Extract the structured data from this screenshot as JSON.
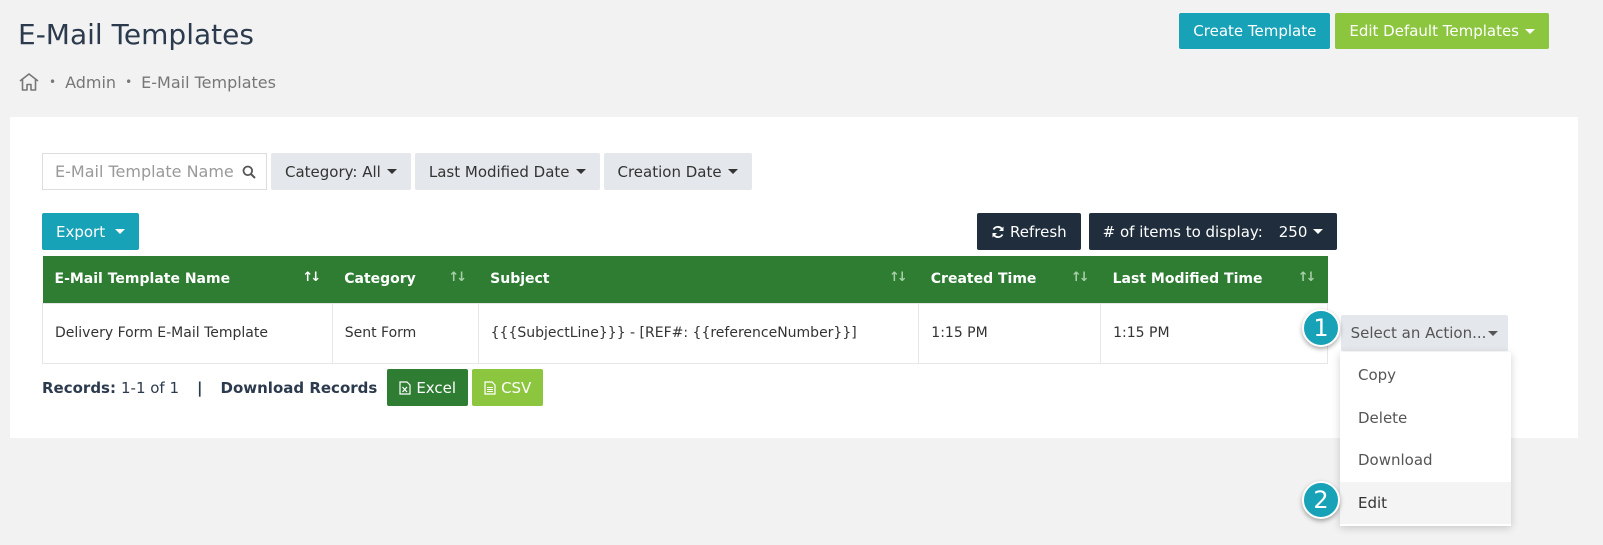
{
  "page": {
    "title": "E-Mail Templates"
  },
  "top_actions": {
    "create_label": "Create Template",
    "edit_defaults_label": "Edit Default Templates"
  },
  "breadcrumb": {
    "sep1": "•",
    "admin": "Admin",
    "sep2": "•",
    "current": "E-Mail Templates"
  },
  "filters": {
    "search_placeholder": "E-Mail Template Name",
    "search_value": "",
    "category_label": "Category: All",
    "last_modified_label": "Last Modified Date",
    "creation_date_label": "Creation Date"
  },
  "toolbar": {
    "export_label": "Export",
    "refresh_label": "Refresh",
    "items_label": "# of items to display:",
    "items_value": "250"
  },
  "table": {
    "headers": [
      "E-Mail Template Name",
      "Category",
      "Subject",
      "Created Time",
      "Last Modified Time"
    ],
    "rows": [
      {
        "name": "Delivery Form E-Mail Template",
        "category": "Sent Form",
        "subject": "{{{SubjectLine}}} - [REF#: {{referenceNumber}}]",
        "created": "1:15 PM",
        "modified": "1:15 PM"
      }
    ]
  },
  "records": {
    "label": "Records:",
    "value": "1-1 of 1",
    "pipe": "|",
    "download_label": "Download Records",
    "excel_label": "Excel",
    "csv_label": "CSV"
  },
  "action_menu": {
    "select_label": "Select an Action...",
    "items": [
      "Copy",
      "Delete",
      "Download",
      "Edit"
    ]
  },
  "badges": {
    "first": "1",
    "second": "2"
  },
  "colors": {
    "teal": "#17a2b8",
    "lime": "#8cc63f",
    "table_header": "#2e7d32",
    "dark": "#1f2d3d"
  }
}
